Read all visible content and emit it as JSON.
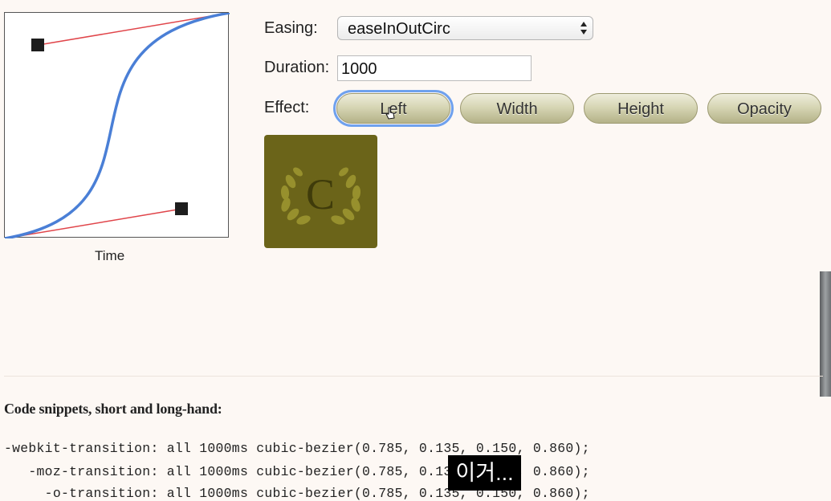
{
  "curve": {
    "easing_name": "easeInOutCirc",
    "bezier": [
      0.785,
      0.135,
      0.15,
      0.86
    ],
    "x_label": "Time"
  },
  "controls": {
    "easing_label": "Easing:",
    "easing_value": "easeInOutCirc",
    "duration_label": "Duration:",
    "duration_value": "1000",
    "effect_label": "Effect:",
    "effects": [
      "Left",
      "Width",
      "Height",
      "Opacity"
    ],
    "focused_effect": "Left"
  },
  "demo": {
    "logo_letter": "C"
  },
  "snippets": {
    "title": "Code snippets, short and long-hand:",
    "lines": [
      "-webkit-transition: all 1000ms cubic-bezier(0.785, 0.135, 0.150, 0.860);",
      "   -moz-transition: all 1000ms cubic-bezier(0.785, 0.135, 0.150, 0.860);",
      "     -o-transition: all 1000ms cubic-bezier(0.785, 0.135, 0.150, 0.860);"
    ]
  },
  "overlay": {
    "caption": "이거..."
  },
  "colors": {
    "curve": "#4a7fd6",
    "handle_line": "#e0454a",
    "demo_box": "#6b6419",
    "focus": "#6fa1ee"
  }
}
